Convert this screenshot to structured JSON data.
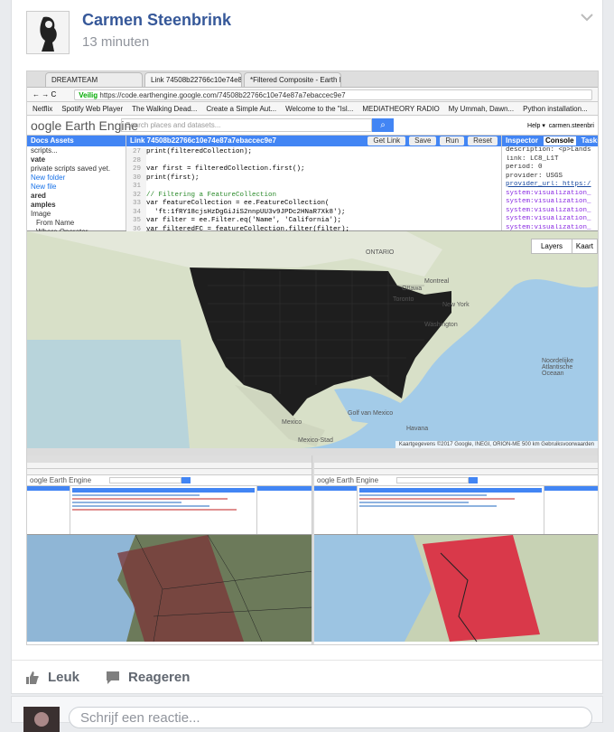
{
  "post": {
    "author": "Carmen Steenbrink",
    "time": "13 minuten"
  },
  "browser": {
    "tabs": [
      "DREAMTEAM",
      "Link 74508b22766c10e74e87a7",
      "*Filtered Composite - Earth En"
    ],
    "secure_label": "Veilig",
    "url_host": "https://code.earthengine.google.com",
    "url_path": "/74508b22766c10e74e87a7ebaccec9e7",
    "bookmarks": [
      "Netflix",
      "Spotify Web Player",
      "The Walking Dead...",
      "Create a Simple Aut...",
      "Welcome to the \"Isl...",
      "MEDIATHEORY RADIO",
      "My Ummah, Dawn...",
      "Python installation..."
    ]
  },
  "gee": {
    "logo": "oogle Earth Engine",
    "search_placeholder": "Search places and datasets...",
    "help": "Help ▾",
    "user": "carmen.steenbri",
    "scripts_tabs": "Docs   Assets",
    "scripts_lines": [
      "scripts...",
      "vate",
      "private scripts saved yet.",
      "New folder",
      "New file",
      "ared",
      "amples",
      "Image",
      "From Name",
      "Where Operator"
    ],
    "editor_title": "Link 74508b22766c10e74e87a7ebaccec9e7",
    "editor_buttons": [
      "Get Link",
      "Save",
      "Run",
      "Reset"
    ],
    "code": [
      {
        "n": "27",
        "t": "print(filteredCollection);"
      },
      {
        "n": "28",
        "t": ""
      },
      {
        "n": "29",
        "t": "var first = filteredCollection.first();"
      },
      {
        "n": "30",
        "t": "print(first);"
      },
      {
        "n": "31",
        "t": ""
      },
      {
        "n": "32",
        "t": "// Filtering a FeatureCollection"
      },
      {
        "n": "33",
        "t": "var featureCollection = ee.FeatureCollection("
      },
      {
        "n": "34",
        "t": "  'ft:1fRY18cjsHzDgGiJiS2nnpUU3v9JPDc2HNaR7Xk8');"
      },
      {
        "n": "35",
        "t": "var filter = ee.Filter.eq('Name', 'California');"
      },
      {
        "n": "36",
        "t": "var filteredFC = featureCollection.filter(filter);"
      },
      {
        "n": "37",
        "t": "Map.addLayer(filteredFC, {}, 'California');"
      }
    ],
    "console_tabs": [
      "Inspector",
      "Console",
      "Tasks"
    ],
    "console_lines": [
      "description: <p>Lands",
      "link: LC8_L1T",
      "period: 0",
      "provider: USGS",
      "provider_url: https:/",
      "system:visualization_",
      "system:visualization_",
      "system:visualization_",
      "system:visualization_",
      "system:visualization_"
    ],
    "map_layers": "Layers",
    "map_kaart": "Kaart",
    "map_labels": [
      "ONTARIO",
      "Ottawa",
      "Montreal",
      "Toronto",
      "New York",
      "Washington",
      "Mexico",
      "Golf van Mexico",
      "Havana",
      "Noordelijke Atlantische Oceaan",
      "Mexico-Stad"
    ],
    "attribution": "Kaartgegevens ©2017 Google, INEGI, ORION-ME   500 km   Gebruiksvoorwaarden"
  },
  "mini_screens": [
    {
      "logo": "oogle Earth Engine"
    },
    {
      "logo": "oogle Earth Engine"
    }
  ],
  "actions": {
    "like": "Leuk",
    "comment": "Reageren"
  },
  "comment_box": {
    "placeholder": "Schrijf een reactie..."
  }
}
